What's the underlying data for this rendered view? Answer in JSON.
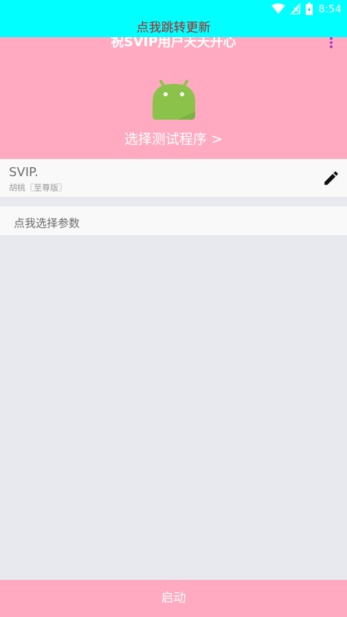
{
  "status_bar": {
    "time": "8:54",
    "icons": [
      "wifi-icon",
      "signal-icon",
      "battery-icon"
    ],
    "background": "#00FFFF"
  },
  "update_banner": {
    "text": "点我跳转更新",
    "color": "#B22222"
  },
  "header": {
    "title": "祝SVIP用户天天开心",
    "select_program": "选择测试程序 >",
    "logo": "android-logo",
    "background": "#FFAAC1",
    "menu_icon": "more-vert-icon"
  },
  "profile": {
    "name": "SVIP.",
    "subtitle": "胡桃〖至尊版〗",
    "edit_icon": "pencil-icon"
  },
  "params": {
    "label": "点我选择参数"
  },
  "start_button": {
    "label": "启动",
    "background": "#FFAAC1"
  }
}
